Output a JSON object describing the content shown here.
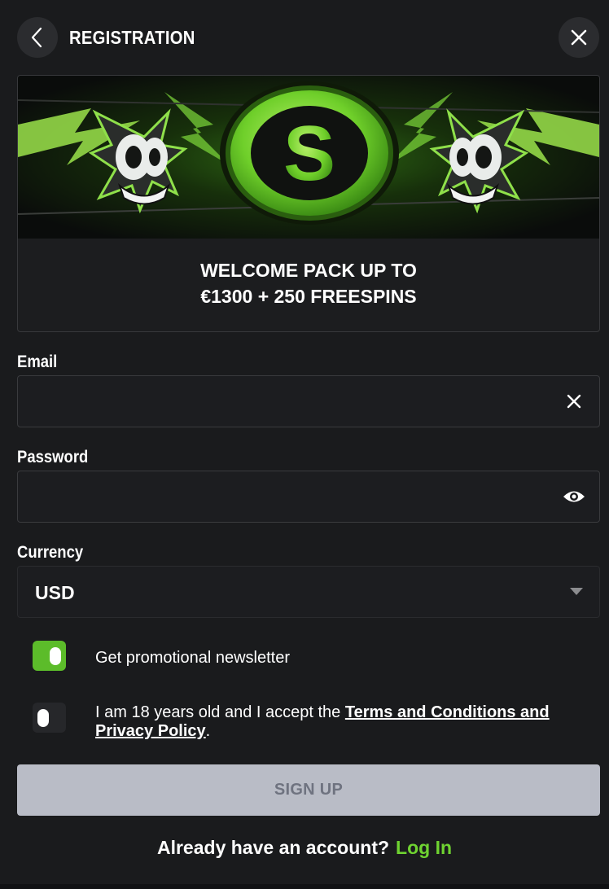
{
  "header": {
    "title": "REGISTRATION",
    "back_icon": "chevron-left-icon",
    "close_icon": "close-icon"
  },
  "promo": {
    "banner_letter": "S",
    "line1": "WELCOME PACK UP TO",
    "line2": "€1300 + 250 FREESPINS",
    "accent_color": "#7ed93a"
  },
  "form": {
    "email": {
      "label": "Email",
      "value": "",
      "clear_icon": "close-icon"
    },
    "password": {
      "label": "Password",
      "value": "",
      "reveal_icon": "eye-icon"
    },
    "currency": {
      "label": "Currency",
      "selected": "USD",
      "caret_icon": "caret-down-icon"
    },
    "newsletter": {
      "label": "Get promotional newsletter",
      "checked": true
    },
    "terms": {
      "prefix": "I am 18 years old and I accept the ",
      "link_text": "Terms and Conditions and Privacy Policy",
      "suffix": ".",
      "checked": false
    },
    "submit_label": "SIGN UP"
  },
  "footer": {
    "prompt": "Already have an account?",
    "login_label": "Log In",
    "login_color": "#6fd331"
  },
  "colors": {
    "background": "#1a1b1d",
    "toggle_on": "#5cbc2a",
    "button_disabled": "#b9bcc6"
  }
}
